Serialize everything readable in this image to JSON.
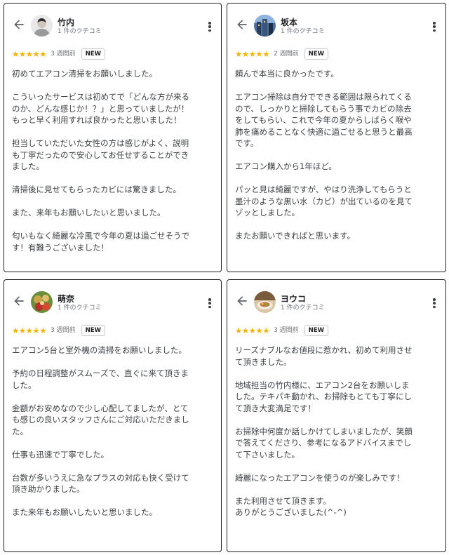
{
  "reviews": [
    {
      "name": "竹内",
      "count": "1 件のクチコミ",
      "stars": "★★★★★",
      "ago": "3 週間前",
      "badge": "NEW",
      "paragraphs": [
        "初めてエアコン清掃をお願いしました。",
        "こういったサービスは初めてで「どんな方が来る\nのか、どんな感じか！？」と思っていましたが！\nもっと早く利用すれば良かったと思いました！",
        "担当していただいた女性の方は感じがよく、説明\nも丁寧だったので安心してお任せすることができ\nました。",
        "清掃後に見せてもらったカビには驚きました。",
        "また、来年もお願いしたいと思いました。",
        "匂いもなく綺麗な冷風で今年の夏は過ごせそうで\nす！有難うございました！"
      ]
    },
    {
      "name": "坂本",
      "count": "1 件のクチコミ",
      "stars": "★★★★★",
      "ago": "2 週間前",
      "badge": "NEW",
      "paragraphs": [
        "頼んで本当に良かったです。",
        "エアコン掃除は自分でできる範囲は限られてくる\nので、しっかりと掃除してもらう事でカビの除去\nをしてもらい、これで今年の夏からしばらく喉や\n肺を痛めることなく快適に過ごせると思うと最高\nです。",
        "エアコン購入から1年ほど。",
        "パッと見は綺麗ですが、やはり洗浄してもらうと\n墨汁のような黒い水（カビ）が出ているのを見て\nゾッとしました。",
        "またお願いできればと思います。"
      ]
    },
    {
      "name": "萌奈",
      "count": "1 件のクチコミ",
      "stars": "★★★★★",
      "ago": "3 週間前",
      "badge": "NEW",
      "paragraphs": [
        "エアコン5台と室外機の清掃をお願いしました。",
        "予約の日程調整がスムーズで、直ぐに来て頂きま\nした。",
        "金額がお安めなので少し心配してましたが、とて\nも感じの良いスタッフさんにご対応いただきまし\nた。",
        "仕事も迅速で丁寧でした。",
        "台数が多いうえに急なプラスの対応も快く受けて\n頂き助かりました。",
        "また来年もお願いしたいと思いました。"
      ]
    },
    {
      "name": "ヨウコ",
      "count": "1 件のクチコミ",
      "stars": "★★★★★",
      "ago": "3 週間前",
      "badge": "NEW",
      "paragraphs": [
        "リーズナブルなお値段に惹かれ、初めて利用させ\nて頂きました。",
        "地域担当の竹内様に、エアコン2台をお願いしま\nした。テキパキ動かれ、お掃除もとても丁寧にし\nて頂き大変満足です！",
        "お掃除中何度か話しかけてしまいましたが、笑顔\nで答えてくださり、参考になるアドバイスまでし\nて下さいました。",
        "綺麗になったエアコンを使うのが楽しみです！",
        "また利用させて頂きます。\nありがとうございました(^-^)"
      ]
    }
  ],
  "icons": {
    "back": "arrow-left-icon",
    "more": "more-vert-icon",
    "star_color": "#f5b400"
  }
}
